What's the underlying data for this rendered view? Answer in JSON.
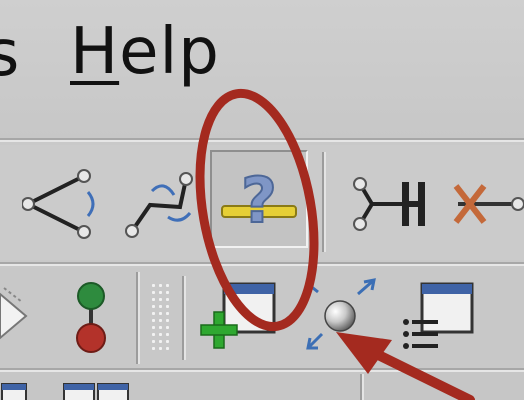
{
  "menubar": {
    "items": [
      {
        "label": "s"
      },
      {
        "label": "Help"
      }
    ]
  },
  "toolbar_top": {
    "buttons": [
      {
        "name": "angle-measure-icon"
      },
      {
        "name": "torsion-measure-icon"
      },
      {
        "name": "query-help-icon",
        "pressed": true
      },
      {
        "name": "hydrogen-bond-icon"
      },
      {
        "name": "delete-bond-icon"
      }
    ]
  },
  "toolbar_bottom": {
    "buttons": [
      {
        "name": "arrow-right-icon"
      },
      {
        "name": "atom-bond-icon"
      },
      {
        "name": "add-window-icon"
      },
      {
        "name": "zoom-fit-icon"
      },
      {
        "name": "list-window-icon"
      }
    ]
  },
  "annotation": {
    "circle_color": "#a42a1f",
    "arrow_color": "#a42a1f"
  }
}
